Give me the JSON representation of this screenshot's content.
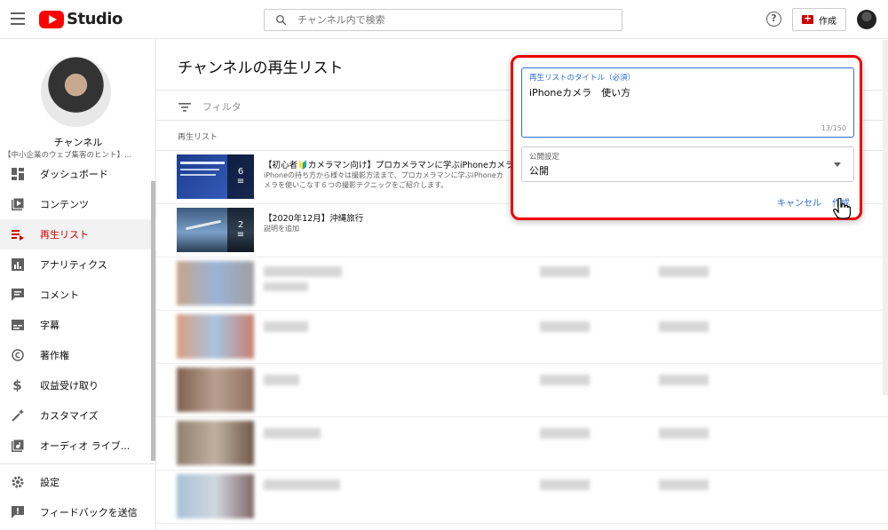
{
  "app": {
    "logo_text": "Studio"
  },
  "search": {
    "placeholder": "チャンネル内で検索"
  },
  "header": {
    "create_label": "作成",
    "help_glyph": "?"
  },
  "channel": {
    "label": "チャンネル",
    "description": "【中小企業のウェブ集客のヒント】..."
  },
  "sidebar": {
    "items": [
      {
        "label": "ダッシュボード",
        "icon": "dashboard-icon"
      },
      {
        "label": "コンテンツ",
        "icon": "content-icon"
      },
      {
        "label": "再生リスト",
        "icon": "playlist-icon",
        "active": true
      },
      {
        "label": "アナリティクス",
        "icon": "analytics-icon"
      },
      {
        "label": "コメント",
        "icon": "comment-icon"
      },
      {
        "label": "字幕",
        "icon": "subtitles-icon"
      },
      {
        "label": "著作権",
        "icon": "copyright-icon"
      },
      {
        "label": "収益受け取り",
        "icon": "dollar-icon"
      },
      {
        "label": "カスタマイズ",
        "icon": "magic-wand-icon"
      },
      {
        "label": "オーディオ ライブ...",
        "icon": "audio-library-icon"
      }
    ],
    "bottom_items": [
      {
        "label": "設定",
        "icon": "gear-icon"
      },
      {
        "label": "フィードバックを送信",
        "icon": "feedback-icon"
      }
    ]
  },
  "main": {
    "title": "チャンネルの再生リスト",
    "filter_label": "フィルタ",
    "column_header": "再生リスト",
    "rows": [
      {
        "title": "【初心者🔰カメラマン向け】プロカメラマンに学ぶiPhoneカメラ",
        "description": "iPhoneの持ち方から様々は撮影方法まで、プロカメラマンに学ぶiPhoneカメラを使いこなす６つの撮影テクニックをご紹介します。",
        "count": "6"
      },
      {
        "title": "【2020年12月】沖縄旅行",
        "description": "説明を追加",
        "count": "2"
      }
    ]
  },
  "dialog": {
    "title_label": "再生リストのタイトル（必須）",
    "title_value": "iPhoneカメラ　使い方",
    "char_count": "13/150",
    "visibility_label": "公開設定",
    "visibility_value": "公開",
    "cancel_label": "キャンセル",
    "create_label": "作成"
  },
  "colors": {
    "accent_red": "#cc0000",
    "link_blue": "#2a6ed6",
    "highlight_border": "#ee0000"
  }
}
